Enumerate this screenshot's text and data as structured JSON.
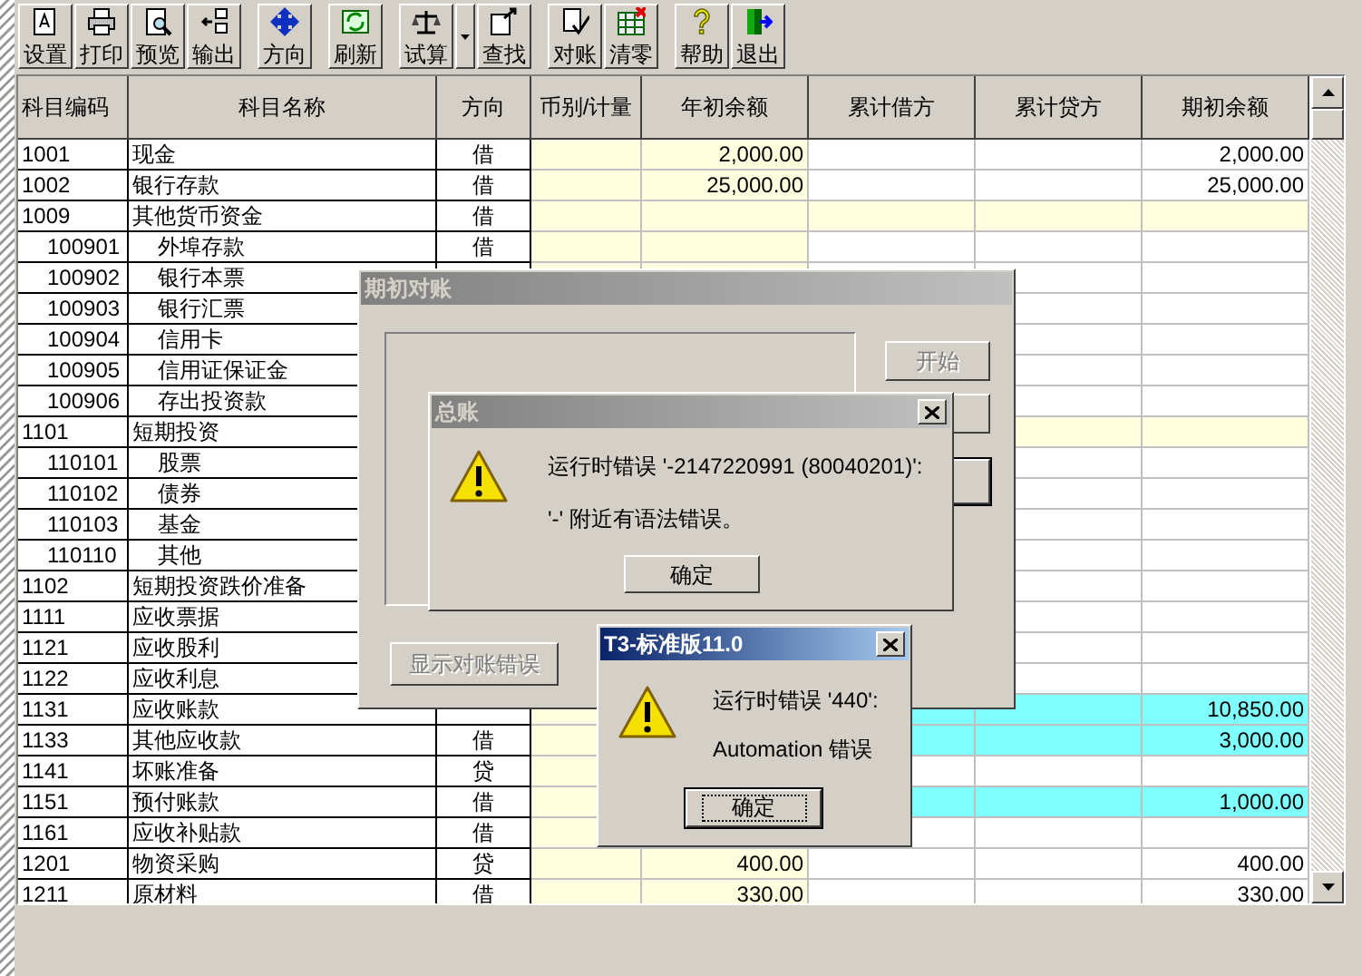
{
  "toolbar": {
    "groups": [
      [
        {
          "kind": "button",
          "label": "设置"
        },
        {
          "kind": "button",
          "label": "打印"
        },
        {
          "kind": "button",
          "label": "预览"
        },
        {
          "kind": "button",
          "label": "输出"
        }
      ],
      [
        {
          "kind": "button",
          "label": "方向"
        }
      ],
      [
        {
          "kind": "button",
          "label": "刷新"
        }
      ],
      [
        {
          "kind": "button",
          "label": "试算"
        },
        {
          "kind": "dropdown"
        },
        {
          "kind": "button",
          "label": "查找"
        }
      ],
      [
        {
          "kind": "button",
          "label": "对账"
        },
        {
          "kind": "button",
          "label": "清零"
        }
      ],
      [
        {
          "kind": "button",
          "label": "帮助"
        },
        {
          "kind": "button",
          "label": "退出"
        }
      ]
    ]
  },
  "table": {
    "columns": [
      "科目编码",
      "科目名称",
      "方向",
      "币别/计量",
      "年初余额",
      "累计借方",
      "累计贷方",
      "期初余额"
    ],
    "rows": [
      {
        "code": "1001",
        "name": "现金",
        "direction": "借",
        "kind": "detail",
        "opening": "2,000.00",
        "balance": "2,000.00"
      },
      {
        "code": "1002",
        "name": "银行存款",
        "direction": "借",
        "kind": "detail",
        "opening": "25,000.00",
        "balance": "25,000.00"
      },
      {
        "code": "1009",
        "name": "其他货币资金",
        "direction": "借",
        "kind": "summary",
        "children": [
          {
            "code": "100901",
            "name": "外埠存款",
            "direction": "借",
            "kind": "detail"
          },
          {
            "code": "100902",
            "name": "银行本票",
            "kind": "detail"
          },
          {
            "code": "100903",
            "name": "银行汇票",
            "kind": "detail"
          },
          {
            "code": "100904",
            "name": "信用卡",
            "kind": "detail"
          },
          {
            "code": "100905",
            "name": "信用证保证金",
            "kind": "detail"
          },
          {
            "code": "100906",
            "name": "存出投资款",
            "kind": "detail"
          }
        ]
      },
      {
        "code": "1101",
        "name": "短期投资",
        "kind": "summary",
        "children": [
          {
            "code": "110101",
            "name": "股票",
            "kind": "detail"
          },
          {
            "code": "110102",
            "name": "债券",
            "kind": "detail"
          },
          {
            "code": "110103",
            "name": "基金",
            "kind": "detail"
          },
          {
            "code": "110110",
            "name": "其他",
            "kind": "detail"
          }
        ]
      },
      {
        "code": "1102",
        "name": "短期投资跌价准备",
        "kind": "detail"
      },
      {
        "code": "1111",
        "name": "应收票据",
        "kind": "detail"
      },
      {
        "code": "1121",
        "name": "应收股利",
        "kind": "detail"
      },
      {
        "code": "1122",
        "name": "应收利息",
        "kind": "detail"
      },
      {
        "code": "1131",
        "name": "应收账款",
        "kind": "flagged",
        "balance": "10,850.00"
      },
      {
        "code": "1133",
        "name": "其他应收款",
        "direction": "借",
        "kind": "flagged",
        "balance": "3,000.00"
      },
      {
        "code": "1141",
        "name": "坏账准备",
        "direction": "贷",
        "kind": "detail"
      },
      {
        "code": "1151",
        "name": "预付账款",
        "direction": "借",
        "kind": "flagged",
        "balance": "1,000.00"
      },
      {
        "code": "1161",
        "name": "应收补贴款",
        "direction": "借",
        "kind": "detail"
      },
      {
        "code": "1201",
        "name": "物资采购",
        "direction": "贷",
        "kind": "detail",
        "opening": "400.00",
        "balance": "400.00"
      },
      {
        "code": "1211",
        "name": "原材料",
        "direction": "借",
        "kind": "detail",
        "opening": "330.00",
        "balance": "330.00"
      }
    ]
  },
  "dialogs": [
    {
      "kind": "reconcile",
      "title": "期初对账",
      "active": false,
      "buttons": [
        {
          "label": "开始",
          "disabled": true
        },
        {
          "label": "显示对账错误",
          "disabled": true
        }
      ]
    },
    {
      "kind": "message",
      "title": "总账",
      "active": false,
      "messages": [
        "运行时错误 '-2147220991 (80040201)':",
        "'-' 附近有语法错误。"
      ],
      "button": {
        "label": "确定",
        "focused": false
      }
    },
    {
      "kind": "message",
      "title": "T3-标准版11.0",
      "active": true,
      "messages": [
        "运行时错误 '440':",
        "Automation 错误"
      ],
      "button": {
        "label": "确定",
        "focused": true
      }
    }
  ]
}
